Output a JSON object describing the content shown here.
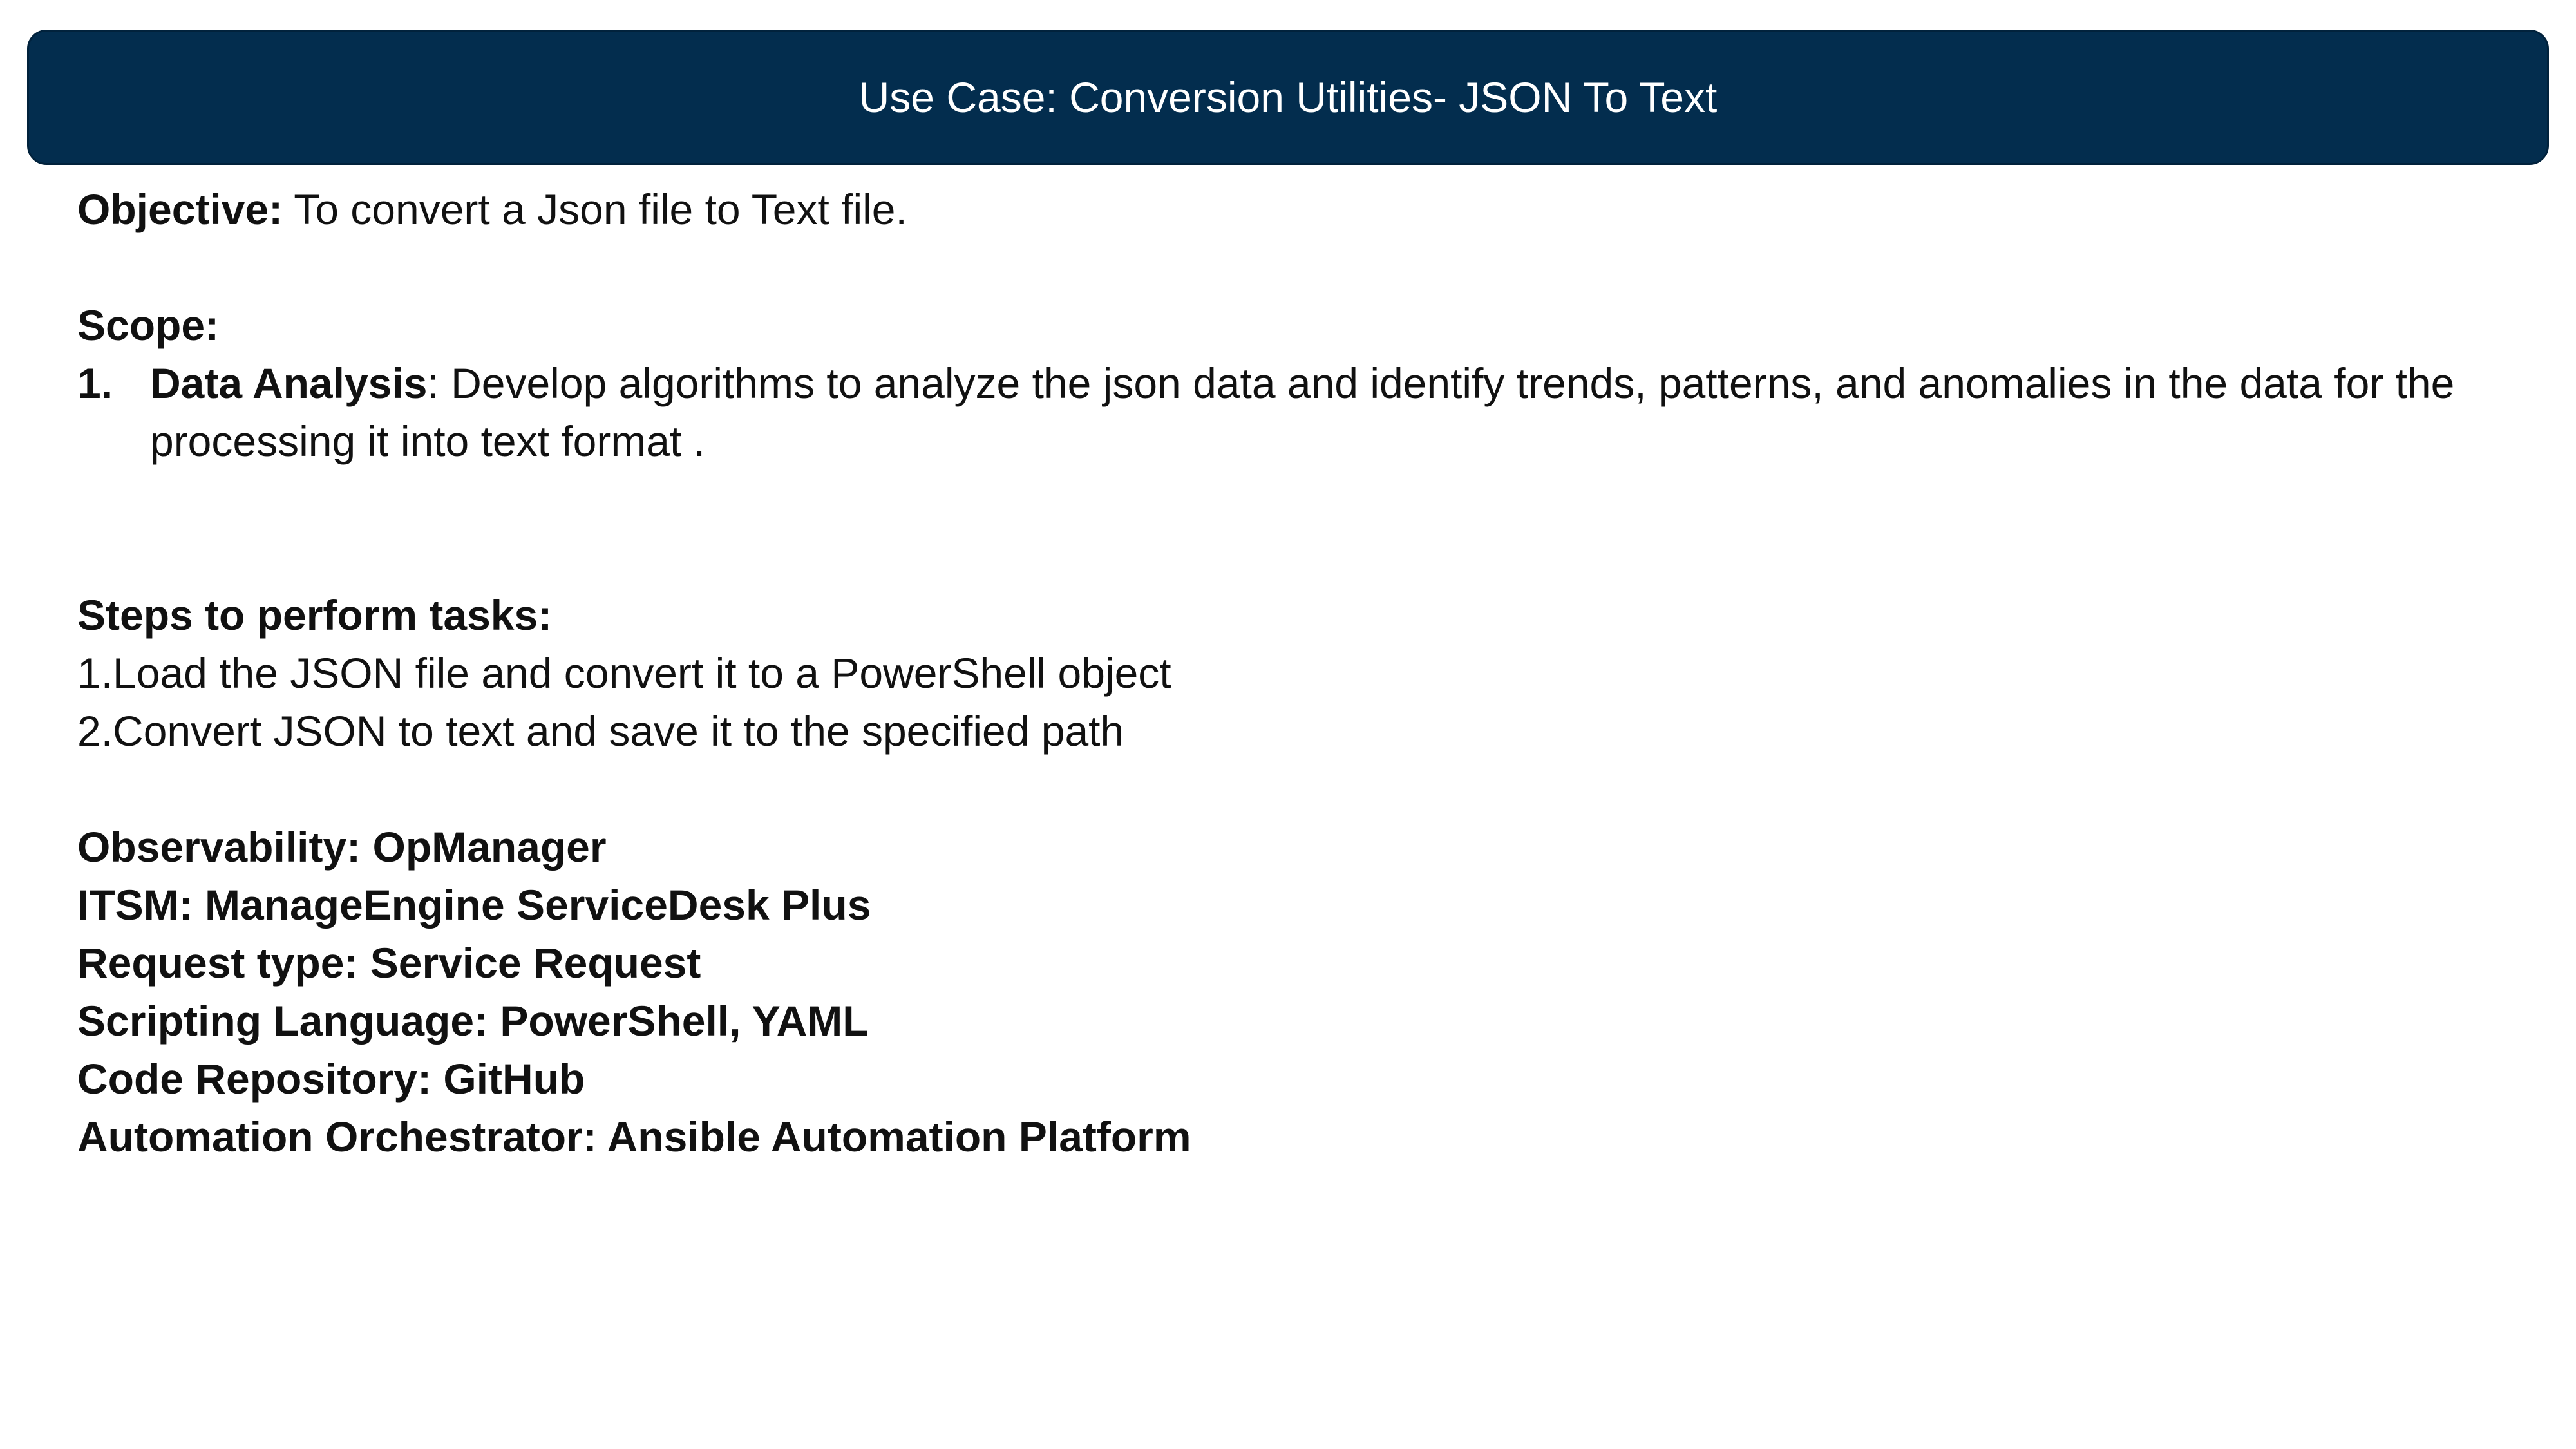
{
  "header": {
    "title": "Use Case: Conversion Utilities- JSON To Text"
  },
  "objective": {
    "label": "Objective:",
    "text": " To convert a Json file to Text file."
  },
  "scope": {
    "heading": "Scope:",
    "items": [
      {
        "number": "1.",
        "title": "Data Analysis",
        "text": ": Develop algorithms to analyze the json data and identify trends, patterns, and anomalies in the data for the processing it into text format ."
      }
    ]
  },
  "steps": {
    "heading": "Steps to perform tasks:",
    "items": [
      "1.Load the JSON file and convert it to a PowerShell object",
      "2.Convert JSON to text and save it to the specified path"
    ]
  },
  "details": [
    "Observability: OpManager",
    "ITSM: ManageEngine ServiceDesk Plus",
    "Request type: Service Request",
    "Scripting Language: PowerShell, YAML",
    "Code Repository: GitHub",
    "Automation Orchestrator: Ansible Automation Platform"
  ],
  "colors": {
    "header_background": "#032d4e",
    "header_text": "#ffffff",
    "body_text": "#111111"
  }
}
